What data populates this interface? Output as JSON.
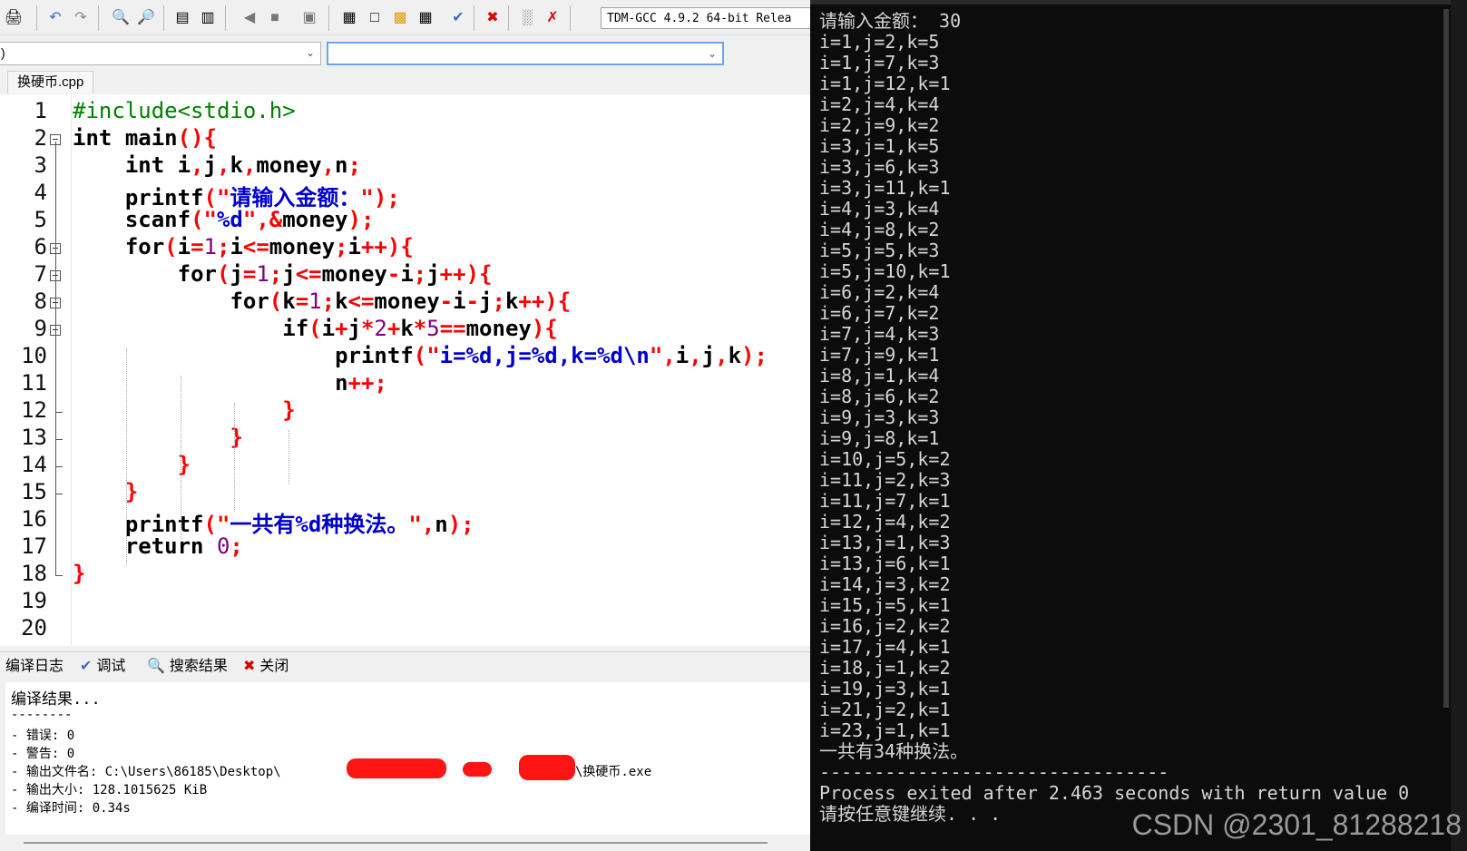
{
  "toolbar": {
    "compiler": "TDM-GCC 4.9.2 64-bit Relea"
  },
  "dropdowns": {
    "left_value": ")",
    "right_value": ""
  },
  "file_tab": {
    "label": "换硬币.cpp"
  },
  "editor": {
    "line_numbers": [
      "1",
      "2",
      "3",
      "4",
      "5",
      "6",
      "7",
      "8",
      "9",
      "10",
      "11",
      "12",
      "13",
      "14",
      "15",
      "16",
      "17",
      "18",
      "19",
      "20"
    ],
    "lines": [
      "#include<stdio.h>",
      "int main(){",
      "    int i,j,k,money,n;",
      "    printf(\"请输入金额：\");",
      "    scanf(\"%d\",&money);",
      "    for(i=1;i<=money;i++){",
      "        for(j=1;j<=money-i;j++){",
      "            for(k=1;k<=money-i-j;k++){",
      "                if(i+j*2+k*5==money){",
      "                    printf(\"i=%d,j=%d,k=%d\\n\",i,j,k);",
      "                    n++;",
      "                }",
      "            }",
      "        }",
      "    }",
      "    printf(\"一共有%d种换法。\",n);",
      "    return 0;",
      "}",
      "",
      ""
    ]
  },
  "panel": {
    "tabs": [
      {
        "label": "编译日志",
        "icon": "compile-log-icon"
      },
      {
        "label": "调试",
        "icon": "check-icon"
      },
      {
        "label": "搜索结果",
        "icon": "search-icon"
      },
      {
        "label": "关闭",
        "icon": "close-icon"
      }
    ],
    "log": [
      "编译结果...",
      "--------",
      "- 错误: 0",
      "- 警告: 0",
      "- 输出文件名: C:\\Users\\86185\\Desktop\\",
      "- 输出大小: 128.1015625 KiB",
      "- 编译时间: 0.34s"
    ],
    "log_filename_tail": "\\换硬币.exe"
  },
  "console": {
    "lines": [
      "请输入金额： 30",
      "i=1,j=2,k=5",
      "i=1,j=7,k=3",
      "i=1,j=12,k=1",
      "i=2,j=4,k=4",
      "i=2,j=9,k=2",
      "i=3,j=1,k=5",
      "i=3,j=6,k=3",
      "i=3,j=11,k=1",
      "i=4,j=3,k=4",
      "i=4,j=8,k=2",
      "i=5,j=5,k=3",
      "i=5,j=10,k=1",
      "i=6,j=2,k=4",
      "i=6,j=7,k=2",
      "i=7,j=4,k=3",
      "i=7,j=9,k=1",
      "i=8,j=1,k=4",
      "i=8,j=6,k=2",
      "i=9,j=3,k=3",
      "i=9,j=8,k=1",
      "i=10,j=5,k=2",
      "i=11,j=2,k=3",
      "i=11,j=7,k=1",
      "i=12,j=4,k=2",
      "i=13,j=1,k=3",
      "i=13,j=6,k=1",
      "i=14,j=3,k=2",
      "i=15,j=5,k=1",
      "i=16,j=2,k=2",
      "i=17,j=4,k=1",
      "i=18,j=1,k=2",
      "i=19,j=3,k=1",
      "i=21,j=2,k=1",
      "i=23,j=1,k=1",
      "一共有34种换法。",
      "--------------------------------",
      "Process exited after 2.463 seconds with return value 0",
      "请按任意键继续. . ."
    ],
    "watermark": "CSDN @2301_81288218"
  },
  "colors": {
    "keyword": "#000000",
    "preprocessor": "#008000",
    "string": "#0000cc",
    "symbol": "#ff0000",
    "number": "#800080",
    "console_bg": "#0c0c0c",
    "console_text": "#d6d6d6",
    "redaction": "#ff1414"
  }
}
